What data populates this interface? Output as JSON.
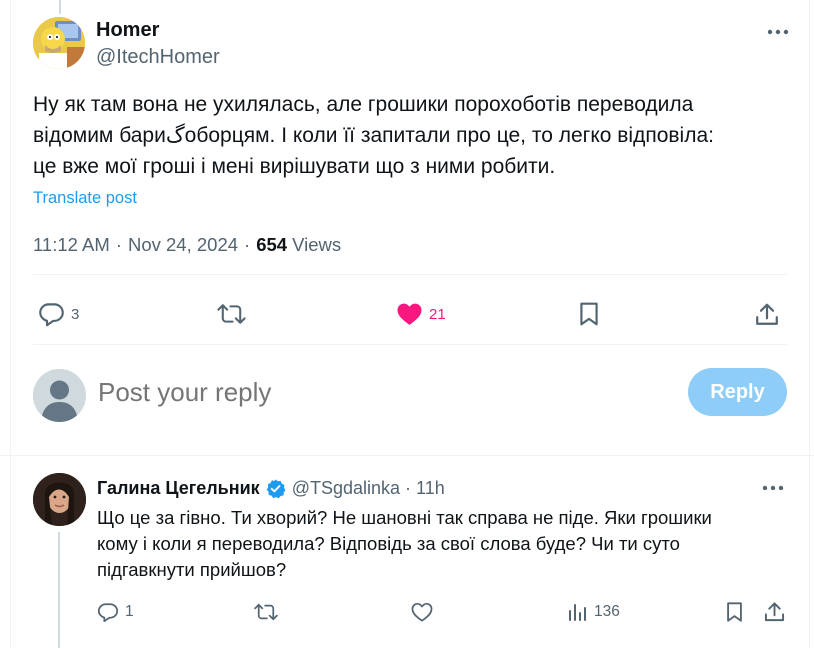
{
  "colors": {
    "accent": "#1d9bf0",
    "like": "#f91880",
    "secondary_text": "#536471",
    "reply_button": "#8ecdf8"
  },
  "post": {
    "author_name": "Homer",
    "author_handle": "@ItechHomer",
    "text": "Ну як там вона не ухилялась, але грошики порохоботів переводила\nвідомим бариگоборцям. І коли її запитали про це, то легко відповіла:\nце вже мої гроші і мені вирішувати що з ними робити.",
    "translate_label": "Translate post",
    "time": "11:12 AM",
    "date": "Nov 24, 2024",
    "separator": "·",
    "views_count": "654",
    "views_label": "Views",
    "stats": {
      "replies": "3",
      "reposts": "",
      "likes": "21"
    },
    "icons": {
      "reply": "reply-icon",
      "repost": "repost-icon",
      "like": "heart-filled-icon",
      "bookmark": "bookmark-icon",
      "share": "share-icon",
      "more": "more-icon"
    }
  },
  "composer": {
    "placeholder": "Post your reply",
    "button_label": "Reply"
  },
  "reply": {
    "author_name": "Галина Цегельник",
    "author_handle": "@TSgdalinka",
    "separator": "·",
    "time": "11h",
    "verified": true,
    "text": "Що це за гівно. Ти хворий? Не  шановні так справа не піде. Яки грошики\nкому і коли я переводила? Відповідь за свої слова буде? Чи ти суто\nпідгавкнути прийшов?",
    "stats": {
      "replies": "1",
      "reposts": "",
      "likes": "",
      "views": "136"
    },
    "icons": {
      "reply": "reply-icon",
      "repost": "repost-icon",
      "like": "heart-icon",
      "views": "analytics-icon",
      "bookmark": "bookmark-icon",
      "share": "share-icon",
      "more": "more-icon"
    }
  }
}
